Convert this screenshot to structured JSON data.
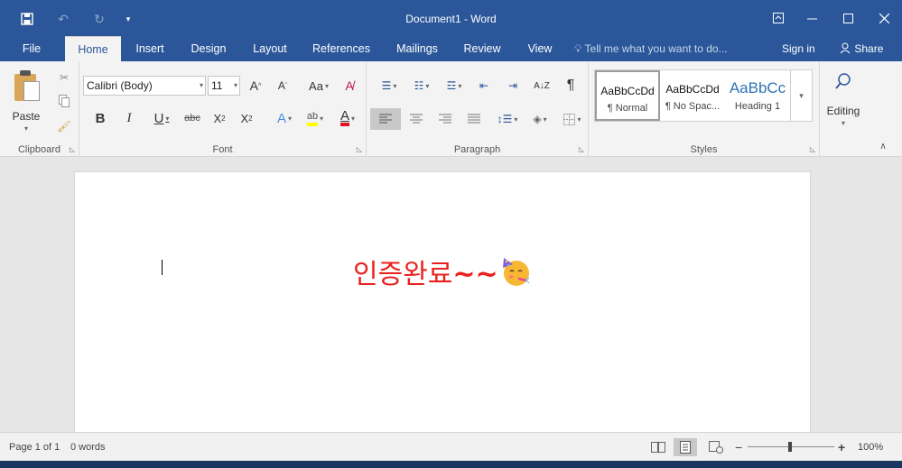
{
  "window": {
    "title": "Document1 - Word",
    "qat_icons": [
      "save-icon",
      "undo-icon",
      "redo-icon",
      "customize-qat-icon"
    ],
    "controls": [
      "ribbon-display-options-icon",
      "minimize-icon",
      "maximize-icon",
      "close-icon"
    ]
  },
  "tabs": [
    {
      "label": "File"
    },
    {
      "label": "Home"
    },
    {
      "label": "Insert"
    },
    {
      "label": "Design"
    },
    {
      "label": "Layout"
    },
    {
      "label": "References"
    },
    {
      "label": "Mailings"
    },
    {
      "label": "Review"
    },
    {
      "label": "View"
    }
  ],
  "active_tab": "Home",
  "tellme": {
    "placeholder": "Tell me what you want to do..."
  },
  "account": {
    "signin": "Sign in",
    "share": "Share"
  },
  "ribbon": {
    "clipboard": {
      "label": "Clipboard",
      "paste": "Paste"
    },
    "font": {
      "label": "Font",
      "font_name": "Calibri (Body)",
      "font_size": "11",
      "bold": "B",
      "italic": "I",
      "underline": "U",
      "strike": "abc",
      "case": "Aa",
      "grow": "A",
      "shrink": "A",
      "highlight_color": "#ffff00",
      "font_color": "#e81123"
    },
    "paragraph": {
      "label": "Paragraph",
      "pilcrow": "¶",
      "sort": "A↓Z"
    },
    "styles": {
      "label": "Styles",
      "items": [
        {
          "sample": "AaBbCcDd",
          "name": "¶ Normal"
        },
        {
          "sample": "AaBbCcDd",
          "name": "¶ No Spac..."
        },
        {
          "sample": "AaBbCc",
          "name": "Heading 1"
        }
      ]
    },
    "editing": {
      "label": "Editing"
    }
  },
  "document": {
    "text": "인증완료",
    "tildes": "~~",
    "text_color": "#e8231f",
    "emoji": "partying-face"
  },
  "status": {
    "page": "Page 1 of 1",
    "words": "0 words",
    "zoom": "100%",
    "zoom_minus": "−",
    "zoom_plus": "+"
  },
  "colors": {
    "accent": "#2b579a"
  }
}
